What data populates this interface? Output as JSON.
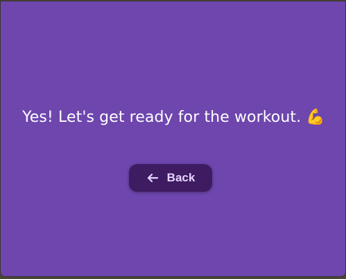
{
  "window": {
    "background_color": "#6e46ae"
  },
  "main": {
    "message": "Yes! Let's get ready for the workout. 💪",
    "back_button": {
      "label": "Back",
      "icon": "arrow-left-icon",
      "background_color": "#3f1b62",
      "text_color": "#e6d5ff"
    }
  }
}
